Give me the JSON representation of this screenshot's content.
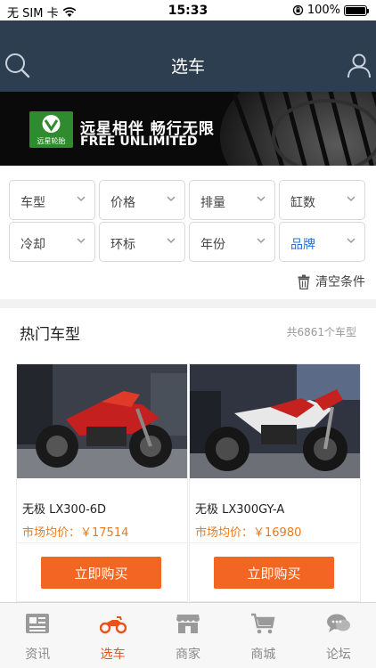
{
  "status_bar": {
    "carrier": "无 SIM 卡",
    "time": "15:33",
    "battery": "100%",
    "battery_level": 1.0
  },
  "nav": {
    "title": "选车",
    "left_icon": "search-icon",
    "right_icon": "user-icon"
  },
  "banner": {
    "slogan": "远星相伴 畅行无限",
    "slogan_en": "FREE UNLIMITED",
    "logo_text": "远星轮胎"
  },
  "filters": {
    "items": [
      {
        "label": "车型"
      },
      {
        "label": "价格"
      },
      {
        "label": "排量"
      },
      {
        "label": "缸数"
      },
      {
        "label": "冷却"
      },
      {
        "label": "环标"
      },
      {
        "label": "年份"
      },
      {
        "label": "品牌"
      }
    ],
    "clear_label": "清空条件",
    "active_color": "#2a6fd6"
  },
  "hot": {
    "title": "热门车型",
    "count": "共6861个车型",
    "cards": [
      {
        "name": "无极 LX300-6D",
        "price": "市场均价：￥17514",
        "buy": "立即购买"
      },
      {
        "name": "无极 LX300GY-A",
        "price": "市场均价：￥16980",
        "buy": "立即购买"
      }
    ]
  },
  "tabs": [
    {
      "label": "资讯",
      "icon": "news-icon"
    },
    {
      "label": "选车",
      "icon": "motorcycle-icon"
    },
    {
      "label": "商家",
      "icon": "store-icon"
    },
    {
      "label": "商城",
      "icon": "cart-icon"
    },
    {
      "label": "论坛",
      "icon": "chat-icon"
    }
  ],
  "colors": {
    "nav_bg": "#2d3e50",
    "accent": "#f26522",
    "price": "#f07818",
    "tab_active": "#e8531c"
  }
}
